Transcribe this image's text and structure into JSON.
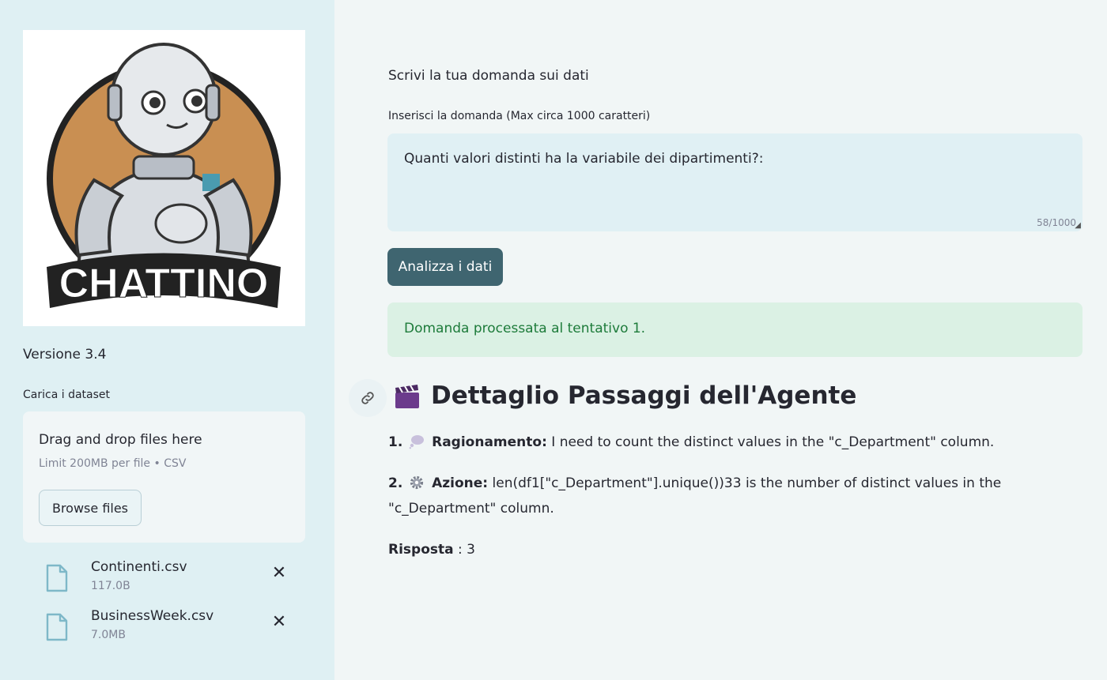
{
  "sidebar": {
    "logo_text": "CHATTINO",
    "version": "Versione 3.4",
    "upload_label": "Carica i dataset",
    "dropzone": {
      "title": "Drag and drop files here",
      "limit": "Limit 200MB per file • CSV",
      "browse_label": "Browse files"
    },
    "files": [
      {
        "name": "Continenti.csv",
        "size": "117.0B"
      },
      {
        "name": "BusinessWeek.csv",
        "size": "7.0MB"
      }
    ]
  },
  "main": {
    "question_title": "Scrivi la tua domanda sui dati",
    "input_label": "Inserisci la domanda (Max circa 1000 caratteri)",
    "question_value": "Quanti valori distinti ha la variabile dei dipartimenti?:",
    "char_count": "58/1000",
    "analyze_label": "Analizza i dati",
    "success_message": "Domanda processata al tentativo 1.",
    "heading": "Dettaglio Passaggi dell'Agente",
    "steps": [
      {
        "number": "1.",
        "icon": "thought-bubble-icon",
        "label": "Ragionamento:",
        "text": "I need to count the distinct values in the \"c_Department\" column."
      },
      {
        "number": "2.",
        "icon": "gear-icon",
        "label": "Azione:",
        "text": "len(df1[\"c_Department\"].unique())33 is the number of distinct values in the \"c_Department\" column."
      }
    ],
    "answer_label": "Risposta",
    "answer_value": ": 3"
  },
  "colors": {
    "sidebar_bg": "#dff0f3",
    "main_bg": "#f1f6f6",
    "primary_button": "#3f6570",
    "success_bg": "#dbf1e4",
    "success_text": "#1d7b3a"
  }
}
